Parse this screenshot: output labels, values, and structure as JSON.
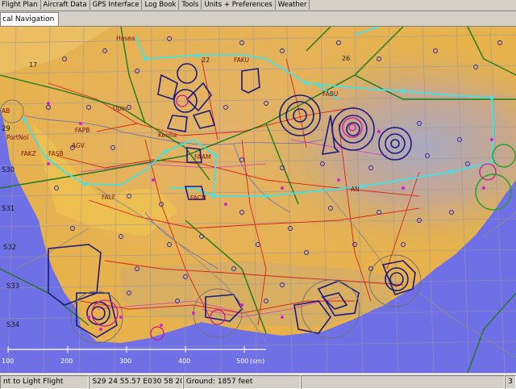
{
  "menu": {
    "tabs": [
      "Flight Plan",
      "Aircraft Data",
      "GPS Interface",
      "Log Book",
      "Tools",
      "Units + Preferences",
      "Weather"
    ]
  },
  "tab_strip": {
    "active_tab": "cal Navigation"
  },
  "map": {
    "latitude_labels": [
      "29",
      "S30",
      "S31",
      "S32",
      "S33",
      "S34"
    ],
    "longitude_labels": [
      "17",
      "22",
      "26"
    ],
    "airfields": [
      "Hosea",
      "FAKU",
      "FABU",
      "Upin",
      "FAPB",
      "PortNol",
      "AGV",
      "Kenha",
      "FAKZ",
      "FASB",
      "FAAM",
      "FALF",
      "FACN",
      "AN",
      "AB"
    ],
    "scale_bar": {
      "ticks": [
        "100",
        "200",
        "300",
        "400",
        "500"
      ],
      "unit": "(sm)"
    }
  },
  "status": {
    "message": "nt to Light Flight",
    "coordinates": "S29 24 55.57  E030 58 20.07",
    "ground": "Ground: 1857 feet",
    "page": "3"
  }
}
